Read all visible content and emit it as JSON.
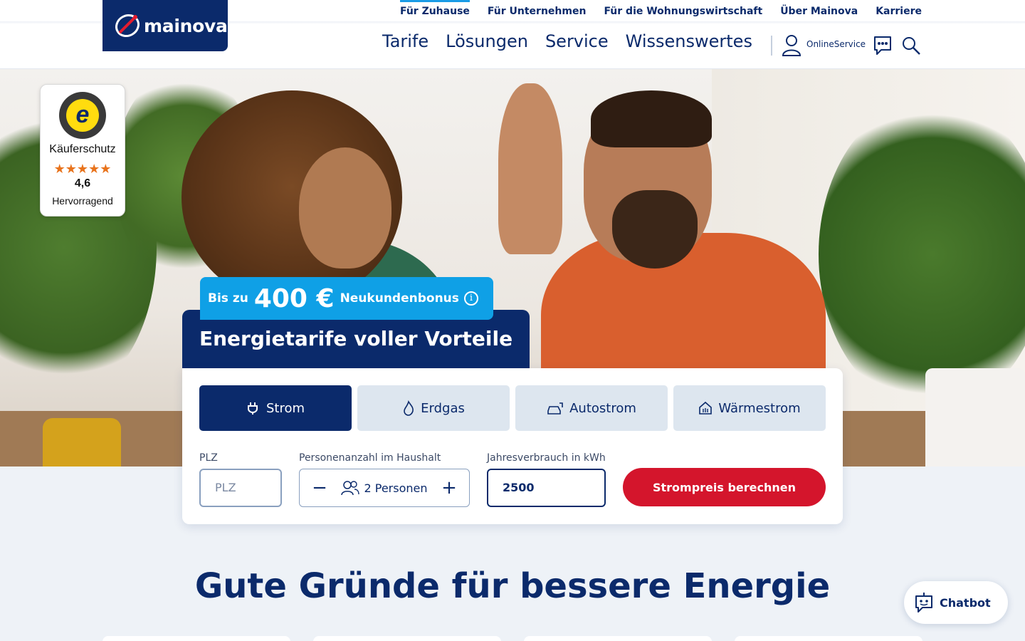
{
  "header": {
    "logo_text": "mainova",
    "top_links": [
      "Für Zuhause",
      "Für Unternehmen",
      "Für die Wohnungswirtschaft",
      "Über Mainova",
      "Karriere"
    ],
    "active_top_link": "Für Zuhause",
    "main_nav": [
      "Tarife",
      "Lösungen",
      "Service",
      "Wissenswertes"
    ],
    "online_service": "OnlineService",
    "icons": [
      "user-icon",
      "chat-icon",
      "search-icon"
    ]
  },
  "trust_badge": {
    "label": "Käuferschutz",
    "stars": "★★★★★",
    "rating": "4,6",
    "rating_text": "Hervorragend"
  },
  "hero": {
    "bonus_prefix": "Bis zu",
    "bonus_amount": "400 €",
    "bonus_suffix": "Neukundenbonus",
    "info_icon": "i",
    "title": "Energietarife voller Vorteile"
  },
  "calculator": {
    "tabs": [
      {
        "label": "Strom",
        "icon": "plug-icon",
        "active": true
      },
      {
        "label": "Erdgas",
        "icon": "flame-icon",
        "active": false
      },
      {
        "label": "Autostrom",
        "icon": "car-charge-icon",
        "active": false
      },
      {
        "label": "Wärmestrom",
        "icon": "house-heat-icon",
        "active": false
      }
    ],
    "plz_label": "PLZ",
    "plz_placeholder": "PLZ",
    "persons_label": "Personenanzahl im Haushalt",
    "persons_value": "2 Personen",
    "minus": "−",
    "plus": "+",
    "kwh_label": "Jahresverbrauch in kWh",
    "kwh_value": "2500",
    "submit": "Strompreis berechnen"
  },
  "section": {
    "title": "Gute Gründe für bessere Energie"
  },
  "chatbot": {
    "label": "Chatbot"
  },
  "colors": {
    "brand_navy": "#0b2a6b",
    "accent_blue": "#0fa0e6",
    "cta_red": "#d4152c",
    "tab_inactive": "#dde6ef"
  }
}
